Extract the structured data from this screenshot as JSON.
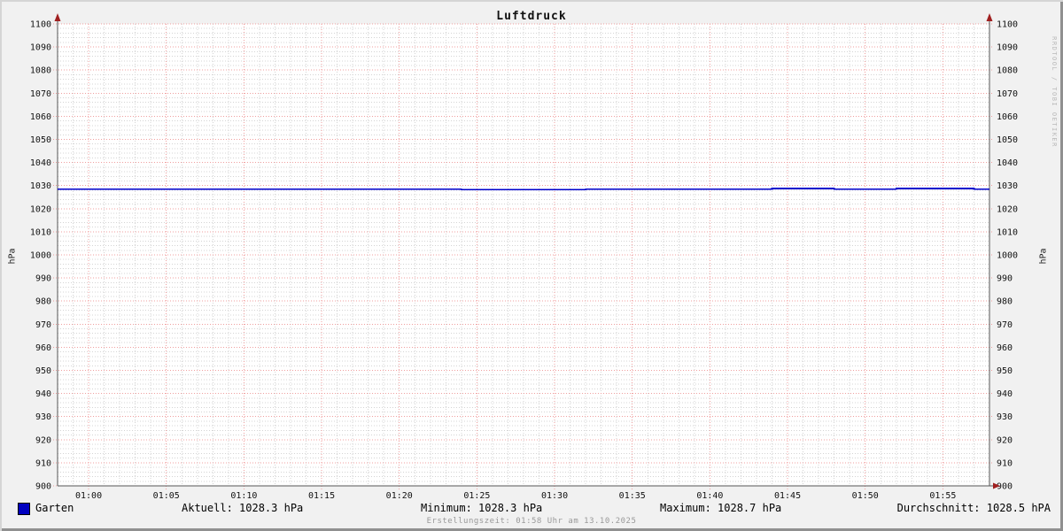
{
  "title": "Luftdruck",
  "watermark": "RRDTOOL / TOBI OETIKER",
  "footer": "Erstellungszeit: 01:58 Uhr am 13.10.2025",
  "legend": {
    "series_label": "Garten",
    "swatch_color": "#0000c0"
  },
  "stats": {
    "aktuell": "Aktuell: 1028.3 hPa",
    "minimum": "Minimum: 1028.3 hPa",
    "maximum": "Maximum: 1028.7 hPa",
    "durchschnitt": "Durchschnitt: 1028.5 hPA"
  },
  "chart_data": {
    "type": "line",
    "title": "Luftdruck",
    "ylabel": "hPa",
    "ylabel_right": "hPa",
    "ylim": [
      900,
      1100
    ],
    "y_major_step": 10,
    "y_minor_step": 2,
    "x_start_time": "00:58",
    "x_end_time": "01:58",
    "x_range_minutes": [
      0,
      60
    ],
    "x_minor_step_minutes": 1,
    "x_ticks": [
      {
        "min": 2,
        "label": "01:00"
      },
      {
        "min": 7,
        "label": "01:05"
      },
      {
        "min": 12,
        "label": "01:10"
      },
      {
        "min": 17,
        "label": "01:15"
      },
      {
        "min": 22,
        "label": "01:20"
      },
      {
        "min": 27,
        "label": "01:25"
      },
      {
        "min": 32,
        "label": "01:30"
      },
      {
        "min": 37,
        "label": "01:35"
      },
      {
        "min": 42,
        "label": "01:40"
      },
      {
        "min": 47,
        "label": "01:45"
      },
      {
        "min": 52,
        "label": "01:50"
      },
      {
        "min": 57,
        "label": "01:55"
      }
    ],
    "grid": {
      "canvas_color": "#ffffff",
      "background_color": "#f1f1f1",
      "major_color": "#f09f9f",
      "minor_color": "#d4d4d4",
      "axis_color": "#555555",
      "arrow_color": "#a02020",
      "grid_on": true
    },
    "series": [
      {
        "name": "Garten",
        "color": "#0000cc",
        "unit": "hPa",
        "stats": {
          "current": 1028.3,
          "min": 1028.3,
          "max": 1028.7,
          "avg": 1028.5
        },
        "values_per_minute": [
          1028.5,
          1028.5,
          1028.5,
          1028.5,
          1028.5,
          1028.5,
          1028.5,
          1028.5,
          1028.5,
          1028.5,
          1028.5,
          1028.5,
          1028.5,
          1028.5,
          1028.5,
          1028.5,
          1028.5,
          1028.5,
          1028.5,
          1028.5,
          1028.5,
          1028.5,
          1028.5,
          1028.5,
          1028.5,
          1028.5,
          1028.3,
          1028.3,
          1028.3,
          1028.3,
          1028.3,
          1028.3,
          1028.3,
          1028.3,
          1028.5,
          1028.5,
          1028.5,
          1028.5,
          1028.5,
          1028.5,
          1028.5,
          1028.5,
          1028.5,
          1028.5,
          1028.5,
          1028.5,
          1028.7,
          1028.7,
          1028.7,
          1028.7,
          1028.5,
          1028.5,
          1028.5,
          1028.5,
          1028.7,
          1028.7,
          1028.7,
          1028.7,
          1028.7,
          1028.5,
          1028.5
        ]
      }
    ]
  }
}
